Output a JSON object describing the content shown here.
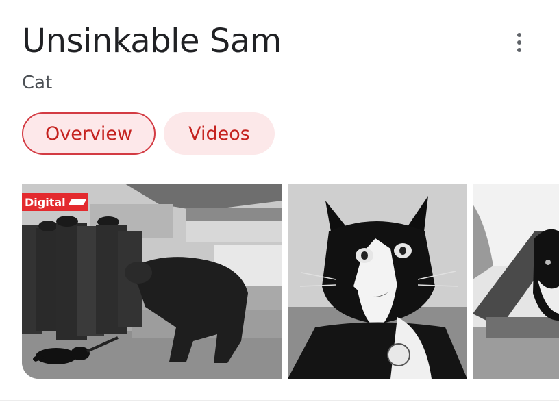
{
  "entity": {
    "title": "Unsinkable Sam",
    "subtitle": "Cat"
  },
  "menu": {
    "more_icon": "more-vertical-icon"
  },
  "tabs": [
    {
      "label": "Overview",
      "active": true
    },
    {
      "label": "Videos",
      "active": false
    }
  ],
  "images": [
    {
      "subject": "Sailors on ship deck with black cat",
      "badge": "Digital"
    },
    {
      "subject": "Black and white cat with collar tag"
    },
    {
      "subject": "Black and white cat on ship railing"
    }
  ],
  "colors": {
    "accent": "#c5221f",
    "tab_bg": "#fde8ea",
    "badge_bg": "#e32a2e"
  }
}
